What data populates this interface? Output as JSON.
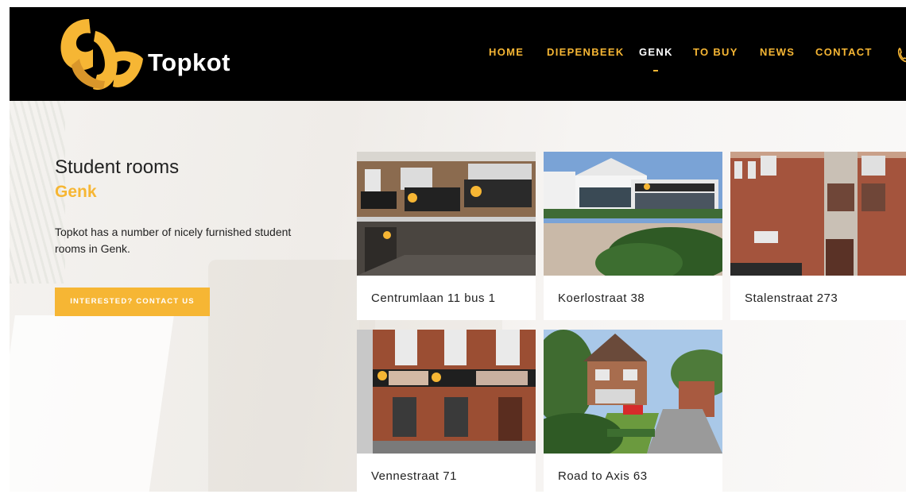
{
  "brand": {
    "name": "Topkot",
    "accent": "#f6b634"
  },
  "nav": {
    "items": [
      {
        "label": "HOME"
      },
      {
        "label": "DIEPENBEEK"
      },
      {
        "label": "GENK",
        "active": true
      },
      {
        "label": "TO BUY"
      },
      {
        "label": "NEWS"
      },
      {
        "label": "CONTACT"
      }
    ],
    "phone_icon": "phone-icon"
  },
  "hero": {
    "title": "Student rooms",
    "subtitle": "Genk",
    "description": "Topkot has a number of nicely furnished student rooms in Genk.",
    "cta_label": "INTERESTED? CONTACT US"
  },
  "properties": [
    {
      "name": "Centrumlaan 11 bus 1"
    },
    {
      "name": "Koerlostraat 38"
    },
    {
      "name": "Stalenstraat 273"
    },
    {
      "name": "Vennestraat 71"
    },
    {
      "name": "Road to Axis 63"
    }
  ]
}
